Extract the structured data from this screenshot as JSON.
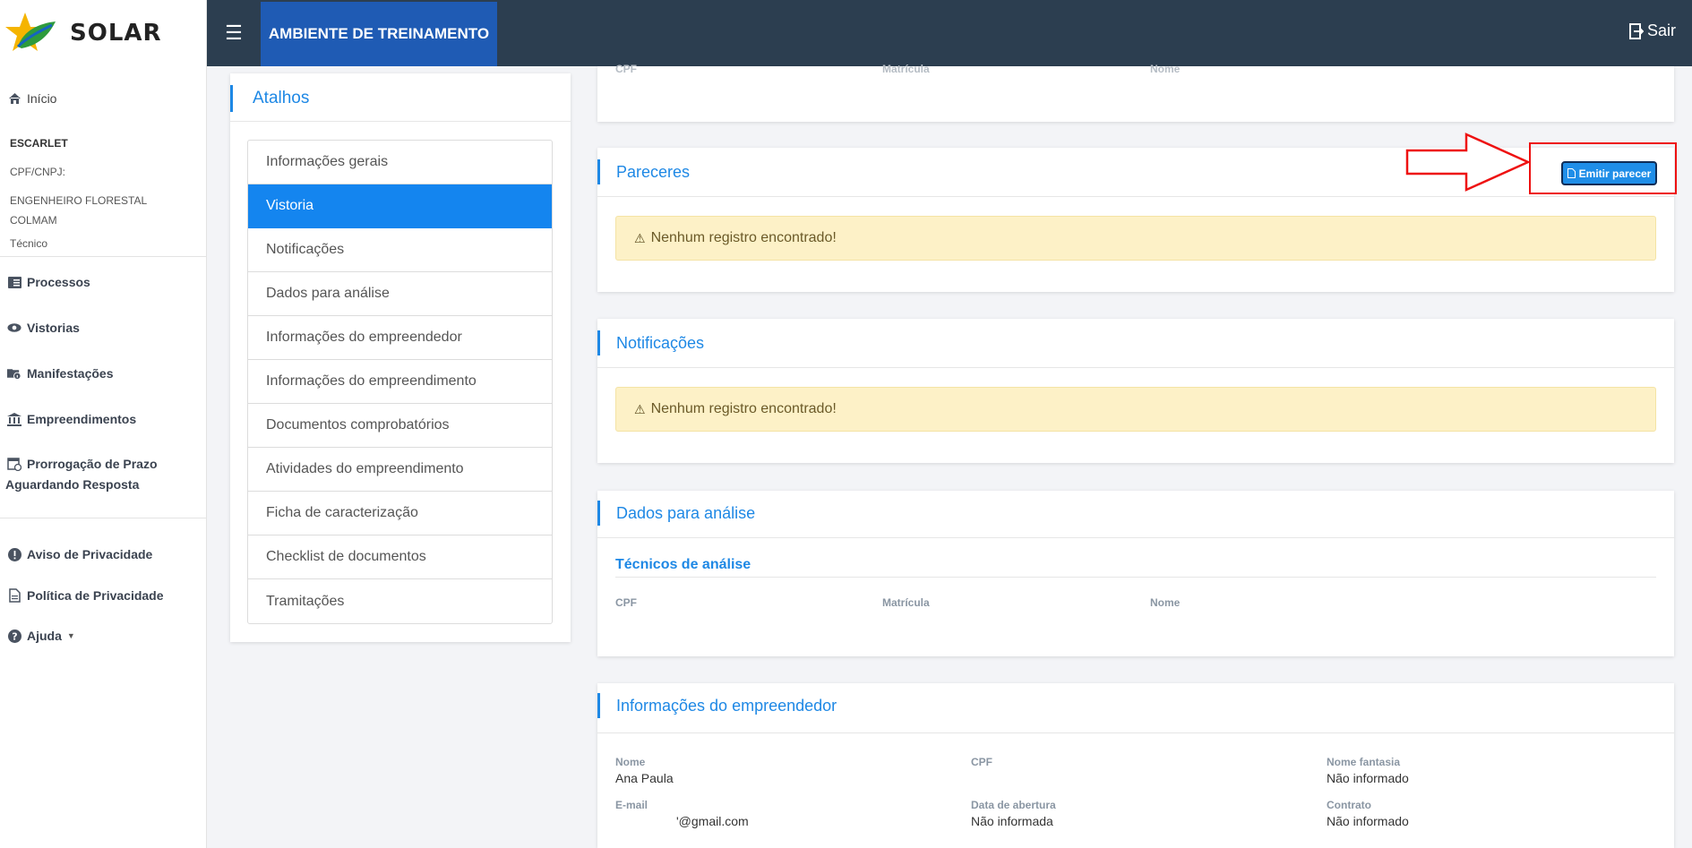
{
  "header": {
    "logo_text": "SOLAR",
    "menu_icon": "hamburger-icon",
    "environment": "AMBIENTE DE TREINAMENTO",
    "logout_label": "Sair"
  },
  "sidebar": {
    "home": "Início",
    "user_name": "ESCARLET",
    "cpf_label": "CPF/CNPJ:",
    "profession": "ENGENHEIRO FLORESTAL",
    "org": "COLMAM",
    "role": "Técnico",
    "nav": [
      {
        "label": "Processos",
        "icon": "processes-icon"
      },
      {
        "label": "Vistorias",
        "icon": "eye-icon"
      },
      {
        "label": "Manifestações",
        "icon": "folder-info-icon"
      },
      {
        "label": "Empreendimentos",
        "icon": "bank-icon"
      },
      {
        "label": "Prorrogação de Prazo",
        "label2": "Aguardando Resposta",
        "icon": "calendar-clock-icon"
      }
    ],
    "footer_links": [
      {
        "label": "Aviso de Privacidade",
        "icon": "exclamation-circle-icon"
      },
      {
        "label": "Política de Privacidade",
        "icon": "document-icon"
      },
      {
        "label": "Ajuda",
        "icon": "question-circle-icon"
      }
    ]
  },
  "atalhos": {
    "title": "Atalhos",
    "items": [
      "Informações gerais",
      "Vistoria",
      "Notificações",
      "Dados para análise",
      "Informações do empreendedor",
      "Informações do empreendimento",
      "Documentos comprobatórios",
      "Atividades do empreendimento",
      "Ficha de caracterização",
      "Checklist de documentos",
      "Tramitações"
    ],
    "active_index": 1
  },
  "top_partial": {
    "labels": [
      "CPF",
      "Matrícula",
      "Nome"
    ]
  },
  "pareceres": {
    "title": "Pareceres",
    "button": "Emitir parecer",
    "empty": "Nenhum registro encontrado!"
  },
  "notificacoes": {
    "title": "Notificações",
    "empty": "Nenhum registro encontrado!"
  },
  "dados_analise": {
    "title": "Dados para análise",
    "subtitle": "Técnicos de análise",
    "labels": [
      "CPF",
      "Matrícula",
      "Nome"
    ]
  },
  "empreendedor": {
    "title": "Informações do empreendedor",
    "fields": [
      {
        "label": "Nome",
        "value": "Ana Paula"
      },
      {
        "label": "CPF",
        "value": ""
      },
      {
        "label": "Nome fantasia",
        "value": "Não informado"
      },
      {
        "label": "E-mail",
        "value": "'@gmail.com"
      },
      {
        "label": "Data de abertura",
        "value": "Não informada"
      },
      {
        "label": "Contrato",
        "value": "Não informado"
      }
    ]
  },
  "colors": {
    "topbar": "#2c3e50",
    "env_tab": "#1f5bb4",
    "accent": "#1e88e5",
    "active_item": "#1485ef",
    "alert_bg": "#fdf1c7",
    "annotation": "#ee1111"
  }
}
